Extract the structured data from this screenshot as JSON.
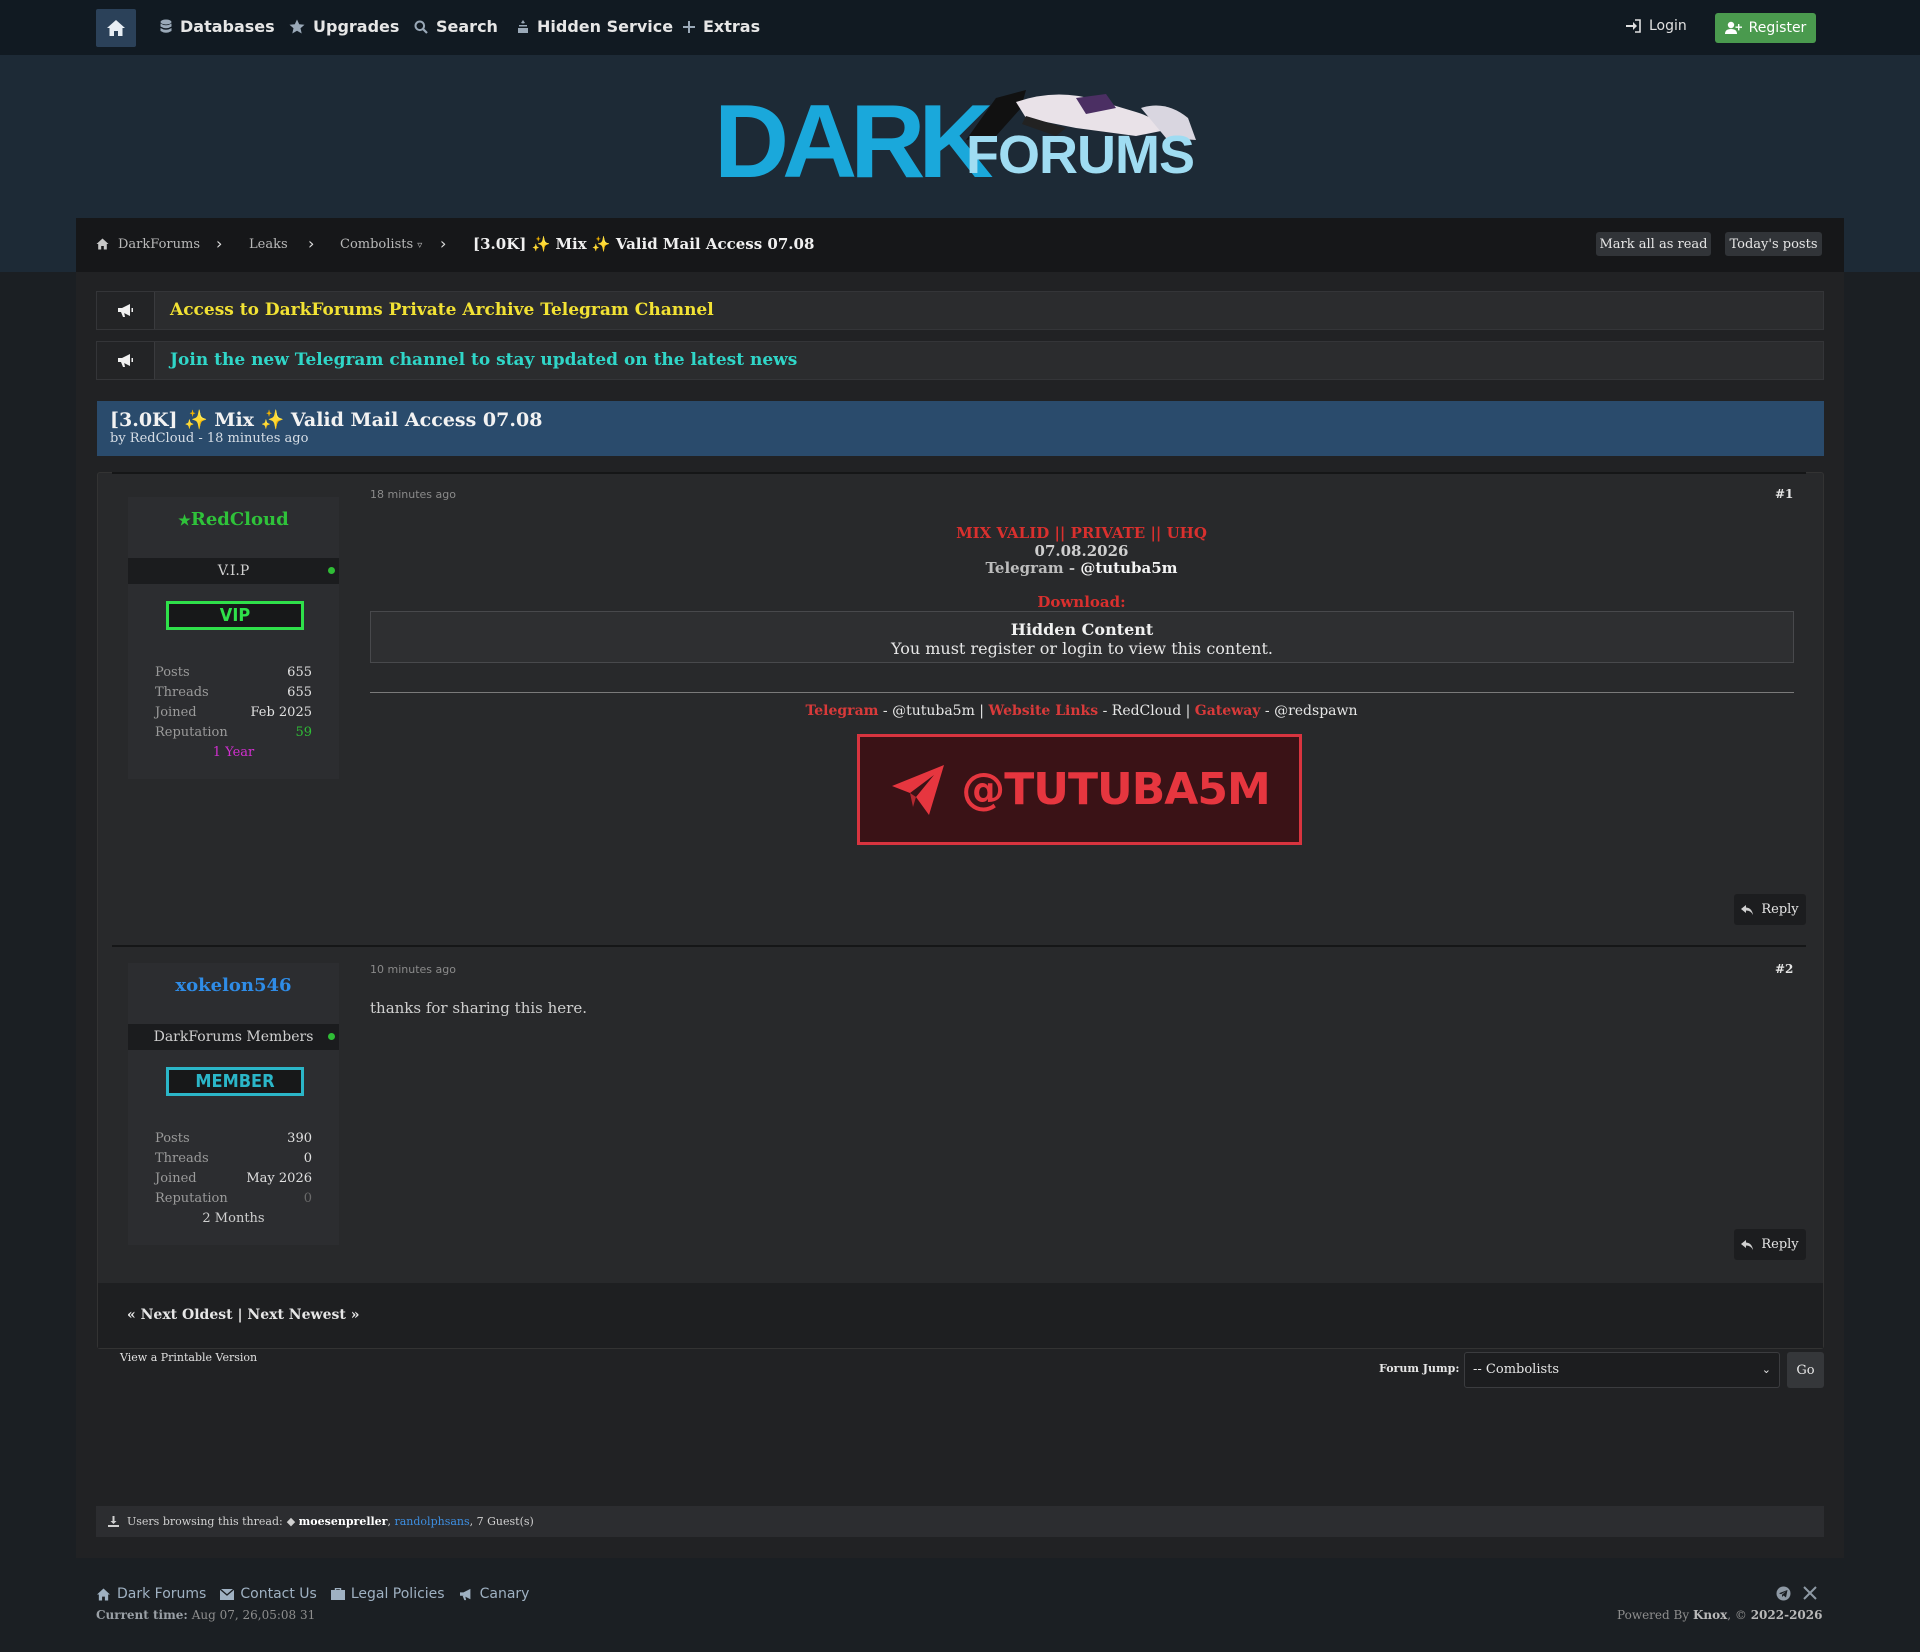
{
  "nav": {
    "items": [
      {
        "label": "Databases",
        "icon": "database-icon"
      },
      {
        "label": "Upgrades",
        "icon": "star-icon"
      },
      {
        "label": "Search",
        "icon": "search-icon"
      },
      {
        "label": "Hidden Service",
        "icon": "tor-onion-icon"
      },
      {
        "label": "Extras",
        "icon": "plus-icon"
      }
    ],
    "login": "Login",
    "register": "Register"
  },
  "logo": {
    "text1": "DARK",
    "text2": "FORUMS"
  },
  "breadcrumb": {
    "home": "DarkForums",
    "leaks": "Leaks",
    "combolists": "Combolists",
    "current": "[3.0K] ✨ Mix ✨ Valid Mail Access 07.08",
    "mark_read": "Mark all as read",
    "todays_posts": "Today's posts"
  },
  "announcements": [
    {
      "text": "Access to DarkForums Private Archive Telegram Channel",
      "color": "#f2e234"
    },
    {
      "text": "Join the new Telegram channel to stay updated on the latest news",
      "color": "#30d6c8"
    }
  ],
  "thread": {
    "title": "[3.0K] ✨ Mix ✨ Valid Mail Access 07.08",
    "byline": "by RedCloud - 18 minutes ago"
  },
  "posts": [
    {
      "time": "18 minutes ago",
      "number": "#1",
      "author": {
        "name": "RedCloud",
        "name_color": "#2fc23a",
        "role": "V.I.P",
        "badge": "VIP",
        "badge_color": "#2fe04a",
        "stats": [
          {
            "k": "Posts",
            "v": "655"
          },
          {
            "k": "Threads",
            "v": "655"
          },
          {
            "k": "Joined",
            "v": "Feb 2025"
          },
          {
            "k": "Reputation",
            "v": "59"
          }
        ],
        "tenure": "1 Year"
      },
      "content": {
        "line1": "MIX VALID || PRIVATE || UHQ",
        "line2": "07.08.2026",
        "line3_prefix": "Telegram - ",
        "line3_handle": "@tutuba5m",
        "download": "Download:",
        "hidden_title": "Hidden Content",
        "hidden_msg": "You must register or login to view this content.",
        "links": {
          "telegram": "Telegram",
          "telegram_val": " - @tutuba5m | ",
          "website": "Website Links",
          "website_val": " - RedCloud | ",
          "gateway": "Gateway",
          "gateway_val": " - @redspawn"
        },
        "banner": "@TUTUBA5M"
      },
      "reply": "Reply"
    },
    {
      "time": "10 minutes ago",
      "number": "#2",
      "author": {
        "name": "xokelon546",
        "name_color": "#2f8ce6",
        "role": "DarkForums Members",
        "badge": "MEMBER",
        "badge_color": "#2bb6c8",
        "stats": [
          {
            "k": "Posts",
            "v": "390"
          },
          {
            "k": "Threads",
            "v": "0"
          },
          {
            "k": "Joined",
            "v": "May 2026"
          },
          {
            "k": "Reputation",
            "v": "0"
          }
        ],
        "tenure": "2 Months"
      },
      "content": {
        "text": "thanks for sharing this here."
      },
      "reply": "Reply"
    }
  ],
  "pager": "« Next Oldest | Next Newest »",
  "printable": "View a Printable Version",
  "forum_jump": {
    "label": "Forum Jump:",
    "selected": "-- Combolists",
    "go": "Go"
  },
  "browsing": {
    "prefix": "Users browsing this thread:",
    "user1": "moesenpreller",
    "user2": "randolphsans",
    "guests": ", 7 Guest(s)"
  },
  "footer": {
    "links": [
      {
        "label": "Dark Forums",
        "icon": "home-icon"
      },
      {
        "label": "Contact Us",
        "icon": "envelope-icon"
      },
      {
        "label": "Legal Policies",
        "icon": "briefcase-icon"
      },
      {
        "label": "Canary",
        "icon": "megaphone-icon"
      }
    ],
    "time_label": "Current time:",
    "time_value": "Aug 07, 26,05:08 31",
    "powered_prefix": "Powered By ",
    "powered_name": "Knox",
    "copyright": ", © ",
    "years": "2022-2026"
  }
}
